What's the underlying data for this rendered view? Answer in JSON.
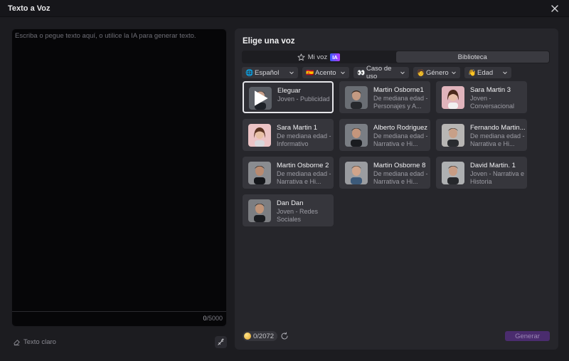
{
  "window": {
    "title": "Texto a Voz"
  },
  "editor": {
    "placeholder": "Escriba o pegue texto aquí, o utilice la IA para generar texto.",
    "count_current": "0",
    "count_max": "/5000",
    "clear_label": "Texto claro"
  },
  "panel": {
    "heading": "Elige una voz",
    "tabs": [
      {
        "label": "Mi voz",
        "badge": "IA",
        "active": false
      },
      {
        "label": "Biblioteca",
        "active": true
      }
    ],
    "filters": [
      {
        "label": "Español",
        "icon": "globe-icon"
      },
      {
        "label": "Acento",
        "icon": "flag-icon"
      },
      {
        "label": "Caso de uso",
        "icon": "eyes-icon"
      },
      {
        "label": "Género",
        "icon": "gender-icon"
      },
      {
        "label": "Edad",
        "icon": "hand-icon"
      }
    ],
    "voices": [
      {
        "name": "Eleguar",
        "desc": "Joven - Publicidad",
        "selected": true
      },
      {
        "name": "Martin Osborne1",
        "desc": "De mediana edad - Personajes y A..."
      },
      {
        "name": "Sara Martin 3",
        "desc": "Joven - Conversacional"
      },
      {
        "name": "Sara Martin 1",
        "desc": "De mediana edad - Informativo"
      },
      {
        "name": "Alberto Rodriguez",
        "desc": "De mediana edad - Narrativa e Hi..."
      },
      {
        "name": "Fernando Martin...",
        "desc": "De mediana edad - Narrativa e Hi..."
      },
      {
        "name": "Martin Osborne 2",
        "desc": "De mediana edad - Narrativa e Hi..."
      },
      {
        "name": "Martin Osborne 8",
        "desc": "De mediana edad - Narrativa e Hi..."
      },
      {
        "name": "David Martin. 1",
        "desc": "Joven - Narrativa e Historia"
      },
      {
        "name": "Dan Dan",
        "desc": "Joven - Redes Sociales"
      }
    ]
  },
  "footer": {
    "credits_used": "0",
    "credits_total": "/2072",
    "generate_label": "Generar"
  },
  "colors": {
    "accent_purple": "#4a2c6e",
    "panel_bg": "#26262b",
    "card_bg": "#36363c"
  }
}
